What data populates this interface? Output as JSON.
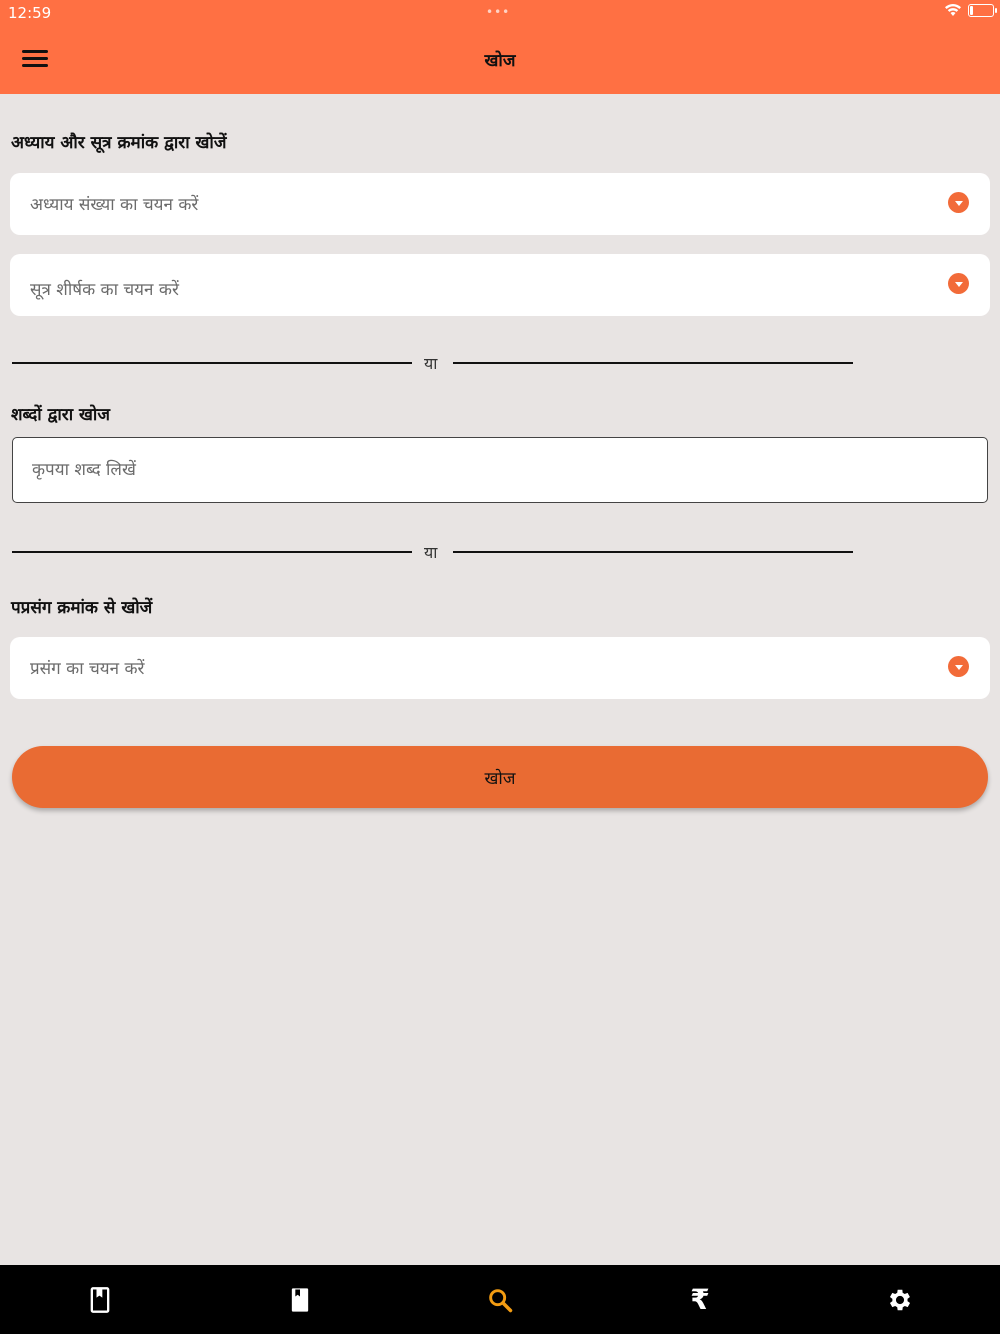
{
  "status_bar": {
    "time": "12:59",
    "dots": "•••",
    "battery_level": 0.12
  },
  "app_bar": {
    "title": "खोज"
  },
  "chapter_section": {
    "title": "अध्याय और सूत्र क्रमांक द्वारा खोजें",
    "chapter_select_placeholder": "अध्याय संख्या का चयन करें",
    "sutra_select_placeholder": "सूत्र शीर्षक का चयन करें"
  },
  "divider_1": {
    "label": "या"
  },
  "word_section": {
    "title": "शब्दों द्वारा खोज",
    "input_placeholder": "कृपया शब्द लिखें"
  },
  "divider_2": {
    "label": "या"
  },
  "prasang_section": {
    "title": "पप्रसंग क्रमांक से खोजें",
    "select_placeholder": "प्रसंग का चयन करें"
  },
  "search_button": {
    "label": "खोज"
  },
  "bottom_nav": {
    "items": [
      {
        "icon": "bookmark-book-icon",
        "active": false
      },
      {
        "icon": "book-icon",
        "active": false
      },
      {
        "icon": "search-icon",
        "active": true
      },
      {
        "icon": "rupee-icon",
        "symbol": "₹",
        "active": false
      },
      {
        "icon": "gear-icon",
        "active": false
      }
    ],
    "active_color": "#f39c12",
    "inactive_color": "#ffffff"
  },
  "colors": {
    "accent": "#ff7043",
    "button": "#e96b33",
    "background": "#e8e4e3"
  }
}
